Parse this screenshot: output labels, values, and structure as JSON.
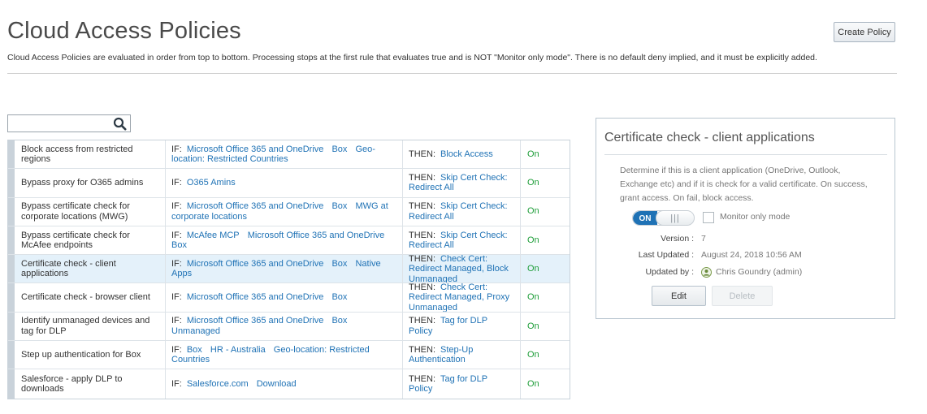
{
  "header": {
    "title": "Cloud Access Policies",
    "description": "Cloud Access Policies are evaluated in order from top to bottom. Processing stops at the first rule that evaluates true and is NOT \"Monitor only mode\". There is no default deny implied, and it must be explicitly added.",
    "create_label": "Create Policy"
  },
  "search": {
    "value": "",
    "placeholder": ""
  },
  "keywords": {
    "if": "IF:",
    "then": "THEN:"
  },
  "policies": [
    {
      "name": "Block access from restricted regions",
      "if": [
        "Microsoft Office 365 and OneDrive",
        "Box",
        "Geo-location: Restricted Countries"
      ],
      "then": [
        "Block Access"
      ],
      "status": "On"
    },
    {
      "name": "Bypass proxy for O365 admins",
      "if": [
        "O365 Amins"
      ],
      "then": [
        "Skip Cert Check: Redirect All"
      ],
      "status": "On"
    },
    {
      "name": "Bypass certificate check for corporate locations (MWG)",
      "if": [
        "Microsoft Office 365 and OneDrive",
        "Box",
        "MWG at corporate locations"
      ],
      "then": [
        "Skip Cert Check: Redirect All"
      ],
      "status": "On"
    },
    {
      "name": "Bypass certificate check for McAfee endpoints",
      "if": [
        "McAfee MCP",
        "Microsoft Office 365 and OneDrive",
        "Box"
      ],
      "then": [
        "Skip Cert Check: Redirect All"
      ],
      "status": "On"
    },
    {
      "name": "Certificate check - client applications",
      "if": [
        "Microsoft Office 365 and OneDrive",
        "Box",
        "Native Apps"
      ],
      "then": [
        "Check Cert: Redirect Managed, Block Unmanaged"
      ],
      "status": "On",
      "selected": true
    },
    {
      "name": "Certificate check - browser client",
      "if": [
        "Microsoft Office 365 and OneDrive",
        "Box"
      ],
      "then": [
        "Check Cert: Redirect Managed, Proxy Unmanaged"
      ],
      "status": "On"
    },
    {
      "name": "Identify unmanaged devices and tag for DLP",
      "if": [
        "Microsoft Office 365 and OneDrive",
        "Box",
        "Unmanaged"
      ],
      "then": [
        "Tag for DLP Policy"
      ],
      "status": "On"
    },
    {
      "name": "Step up authentication for Box",
      "if": [
        "Box",
        "HR - Australia",
        "Geo-location: Restricted Countries"
      ],
      "then": [
        "Step-Up Authentication"
      ],
      "status": "On"
    },
    {
      "name": "Salesforce - apply DLP to downloads",
      "if": [
        "Salesforce.com",
        "Download"
      ],
      "then": [
        "Tag for DLP Policy"
      ],
      "status": "On"
    }
  ],
  "detail": {
    "title": "Certificate check - client applications",
    "description": "Determine if this is a client application (OneDrive, Outlook, Exchange etc) and if it is check for a valid certificate. On success, grant access. On fail, block access.",
    "toggle_label": "ON",
    "toggle_grip": "|||",
    "monitor_label": "Monitor only mode",
    "version_label": "Version :",
    "version_value": "7",
    "updated_label": "Last Updated :",
    "updated_value": "August 24, 2018 10:56 AM",
    "updated_by_label": "Updated by :",
    "updated_by_value": "Chris Goundry (admin)",
    "edit_label": "Edit",
    "delete_label": "Delete"
  },
  "colors": {
    "link": "#1f72b5",
    "status_on": "#1f9e3a",
    "selected_row": "#e4f1fa",
    "toggle_on": "#1f72b5"
  },
  "icons": {
    "search": "search-icon",
    "user": "user-icon"
  }
}
